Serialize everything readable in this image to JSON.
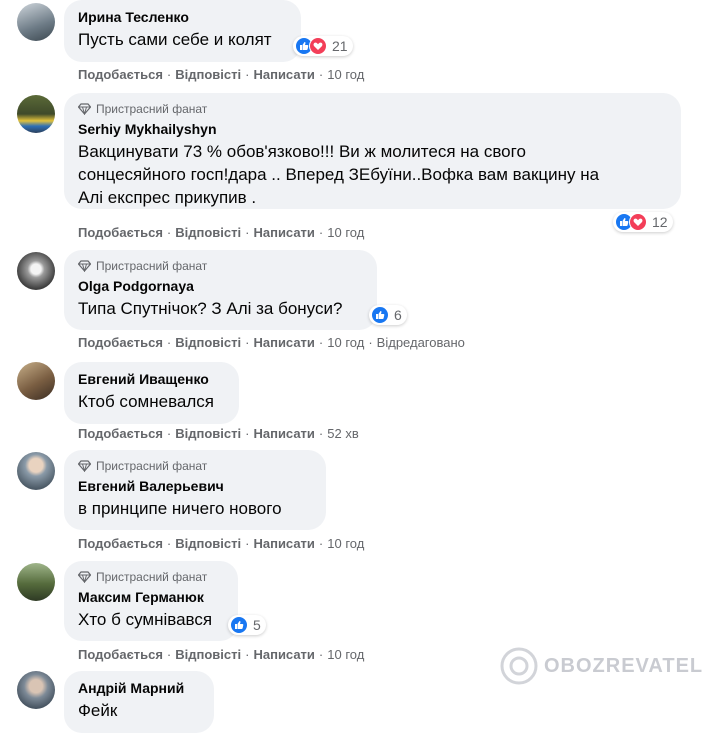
{
  "actions": {
    "like": "Подобається",
    "reply": "Відповісті",
    "write": "Написати"
  },
  "badge_label": "Пристрасний фанат",
  "comments": [
    {
      "author": "Ирина Тесленко",
      "text": "Пусть сами себе и колят",
      "reactions": "21",
      "time": "10 год",
      "edited": ""
    },
    {
      "author": "Serhiy Mykhailyshyn",
      "text": "Вакцинувати 73 % обов'язково!!! Ви ж молитеся на свого\nсонцесяйного госп!дара .. Вперед ЗЕбуїни..Вофка вам вакцину на\nАлі експрес прикупив .",
      "reactions": "12",
      "time": "10 год",
      "edited": ""
    },
    {
      "author": "Olga Podgornaya",
      "text": "Типа Спутнічок? З Алі за бонуси?",
      "reactions": "6",
      "time": "10 год",
      "edited": "Відредаговано"
    },
    {
      "author": "Евгений Иващенко",
      "text": "Ктоб сомневался",
      "time": "52 хв"
    },
    {
      "author": "Евгений Валерьевич",
      "text": "в принципе ничего нового",
      "time": "10 год"
    },
    {
      "author": "Максим Германюк",
      "text": "Хто б сумнівався",
      "reactions": "5",
      "time": "10 год"
    },
    {
      "author": "Андрій Марний",
      "text": "Фейк"
    }
  ],
  "watermark": "OBOZREVATEL"
}
